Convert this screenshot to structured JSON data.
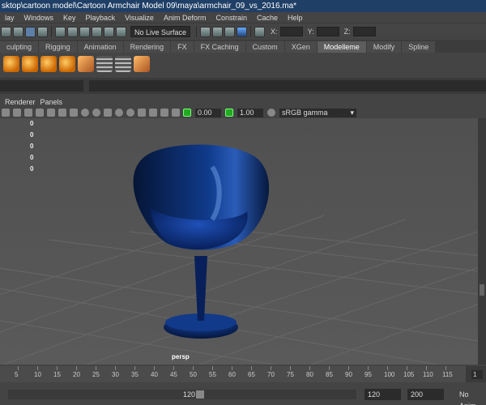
{
  "window": {
    "title": "sktop\\cartoon model\\Cartoon Armchair Model 09\\maya\\armchair_09_vs_2016.ma*"
  },
  "menu": [
    "lay",
    "Windows",
    "Key",
    "Playback",
    "Visualize",
    "Anim Deform",
    "Constrain",
    "Cache",
    "Help"
  ],
  "statusline": {
    "live_surface": "No Live Surface",
    "coord_labels": [
      "X:",
      "Y:",
      "Z:"
    ]
  },
  "shelf_tabs": [
    {
      "label": "culpting",
      "active": false
    },
    {
      "label": "Rigging",
      "active": false
    },
    {
      "label": "Animation",
      "active": false
    },
    {
      "label": "Rendering",
      "active": false
    },
    {
      "label": "FX",
      "active": false
    },
    {
      "label": "FX Caching",
      "active": false
    },
    {
      "label": "Custom",
      "active": false
    },
    {
      "label": "XGen",
      "active": false
    },
    {
      "label": "Modelleme",
      "active": true
    },
    {
      "label": "Modify",
      "active": false
    },
    {
      "label": "Spline",
      "active": false
    }
  ],
  "panel_menu": [
    "Renderer",
    "Panels"
  ],
  "viewbar": {
    "exposure": "0.00",
    "gamma": "1.00",
    "color_space": "sRGB gamma"
  },
  "hud": [
    "0",
    "0",
    "0",
    "0",
    "0"
  ],
  "camera": "persp",
  "timeline": {
    "ticks": [
      "5",
      "10",
      "15",
      "20",
      "25",
      "30",
      "35",
      "40",
      "45",
      "50",
      "55",
      "60",
      "65",
      "70",
      "75",
      "80",
      "85",
      "90",
      "95",
      "100",
      "105",
      "110",
      "115"
    ],
    "current_frame": "1"
  },
  "range": {
    "slider_end": "120",
    "end": "120",
    "max": "200",
    "anim_layer": "No Anim"
  },
  "colors": {
    "title_bar": "#1f3f66",
    "chair": "#0b2a66",
    "active_tab": "#5d5d5d"
  }
}
